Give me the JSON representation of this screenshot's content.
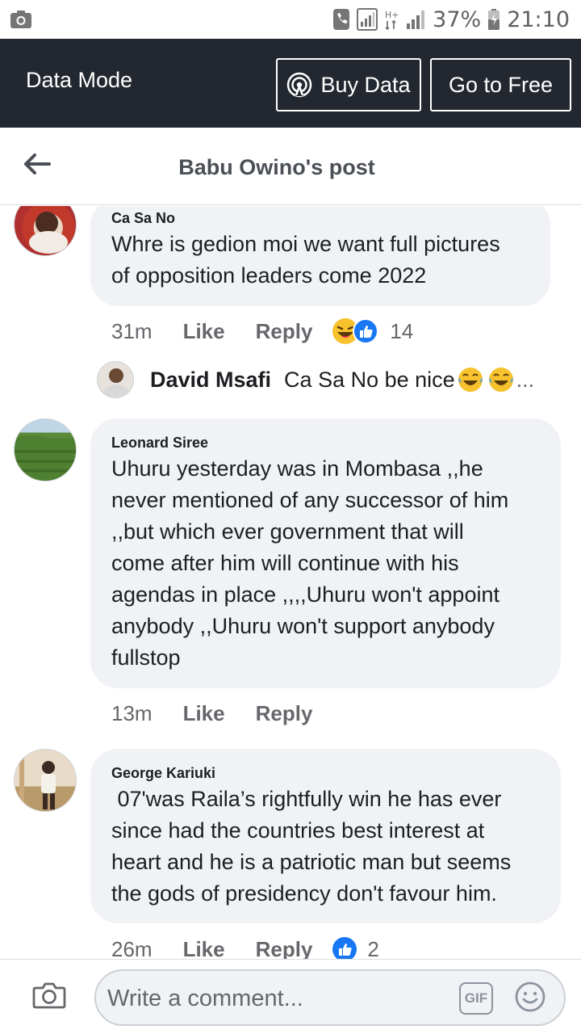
{
  "status_bar": {
    "battery": "37%",
    "time": "21:10"
  },
  "data_bar": {
    "title": "Data Mode",
    "buy_label": "Buy Data",
    "free_label": "Go to Free"
  },
  "post_header": {
    "title": "Babu Owino's post"
  },
  "comments": [
    {
      "author": "Ca Sa No",
      "lines": [
        "Whre is gedion moi we want full pictures",
        "of opposition leaders come 2022"
      ],
      "time": "31m",
      "like": "Like",
      "reply": "Reply",
      "reaction_count": "14",
      "reactions": [
        "haha-icon",
        "like-icon"
      ]
    },
    {
      "author": "Leonard Siree",
      "lines": [
        "Uhuru yesterday was in Mombasa ,,he",
        "never mentioned of any successor of him",
        ",,but which ever government that will",
        "come after him will continue with his",
        "agendas in place ,,,,Uhuru won't appoint",
        "anybody ,,Uhuru won't support anybody",
        "fullstop"
      ],
      "time": "13m",
      "like": "Like",
      "reply": "Reply"
    },
    {
      "author": "George Kariuki",
      "lines": [
        " 07'was Raila’s rightfully win he has ever",
        "since had the countries best interest at",
        "heart and he is a patriotic man but seems",
        "the gods of presidency don't favour him."
      ],
      "time": "26m",
      "like": "Like",
      "reply": "Reply",
      "reaction_count": "2",
      "reactions": [
        "like-icon"
      ]
    }
  ],
  "reply": {
    "author": "David Msafi",
    "text": "Ca Sa No be nice",
    "ellipsis": "..."
  },
  "composer": {
    "placeholder": "Write a comment...",
    "gif_label": "GIF"
  },
  "colors": {
    "data_bar_bg": "#23272f",
    "bubble_bg": "#f0f2f5",
    "like_blue": "#1877f2",
    "haha_yellow": "#f7c22d"
  }
}
